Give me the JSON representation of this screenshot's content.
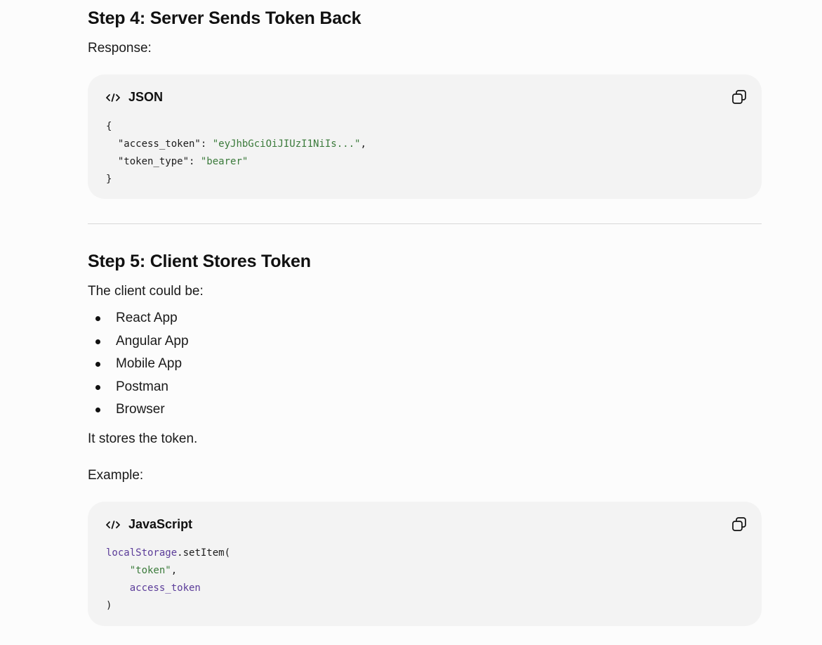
{
  "step4": {
    "heading": "Step 4: Server Sends Token Back",
    "intro": "Response:",
    "code": {
      "language": "JSON",
      "lines": {
        "open": "{",
        "key1": "\"access_token\"",
        "val1": "\"eyJhbGciOiJIUzI1NiIs...\"",
        "key2": "\"token_type\"",
        "val2": "\"bearer\"",
        "close": "}"
      }
    }
  },
  "step5": {
    "heading": "Step 5: Client Stores Token",
    "intro": "The client could be:",
    "clients": [
      "React App",
      "Angular App",
      "Mobile App",
      "Postman",
      "Browser"
    ],
    "stores_text": "It stores the token.",
    "example_label": "Example:",
    "code": {
      "language": "JavaScript",
      "lines": {
        "obj": "localStorage",
        "method": ".setItem(",
        "arg1": "\"token\"",
        "arg2": "access_token",
        "close": ")"
      }
    }
  },
  "icons": {
    "code_icon": "code-brackets-icon",
    "copy_icon": "copy-icon"
  },
  "colors": {
    "string": "#3a7a3a",
    "variable": "#5b3c99",
    "code_bg": "#f3f3f3"
  }
}
